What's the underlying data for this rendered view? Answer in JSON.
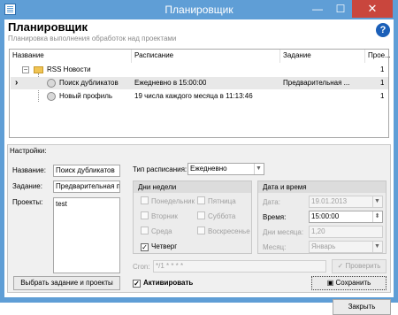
{
  "window": {
    "title": "Планировщик",
    "min_glyph": "—",
    "max_glyph": "☐",
    "close_glyph": "✕"
  },
  "header": {
    "title": "Планировщик",
    "subtitle": "Планировка выполнения обработок над проектами",
    "help_glyph": "?"
  },
  "tree": {
    "columns": [
      "Название",
      "Расписание",
      "Задание",
      "Прое..."
    ],
    "expander_glyph": "−",
    "current_row_glyph": "›",
    "rows": [
      {
        "name": "RSS Новости",
        "schedule": "",
        "task": "",
        "projects": "1",
        "type": "folder"
      },
      {
        "name": "Поиск дубликатов",
        "schedule": "Ежедневно в 15:00:00",
        "task": "Предварительная ...",
        "projects": "1",
        "type": "task",
        "selected": true
      },
      {
        "name": "Новый профиль",
        "schedule": "19 числа каждого месяца в 11:13:46",
        "task": "",
        "projects": "1",
        "type": "task"
      }
    ]
  },
  "settings": {
    "title": "Настройки:",
    "name_label": "Название:",
    "name_value": "Поиск дубликатов",
    "task_label": "Задание:",
    "task_value": "Предварительная пс",
    "projects_label": "Проекты:",
    "projects_value": "test",
    "select_button": "Выбрать задание и проекты",
    "schedule_type_label": "Тип расписания:",
    "schedule_type_value": "Ежедневно",
    "weekdays_title": "Дни недели",
    "weekdays": [
      {
        "label": "Понедельник",
        "checked": false
      },
      {
        "label": "Пятница",
        "checked": false
      },
      {
        "label": "Вторник",
        "checked": false
      },
      {
        "label": "Суббота",
        "checked": false
      },
      {
        "label": "Среда",
        "checked": false
      },
      {
        "label": "Воскресенье",
        "checked": false
      },
      {
        "label": "Четверг",
        "checked": true
      }
    ],
    "datetime_title": "Дата и время",
    "date_label": "Дата:",
    "date_value": "19.01.2013",
    "time_label": "Время:",
    "time_value": "15:00:00",
    "monthdays_label": "Дни месяца:",
    "monthdays_value": "1,20",
    "month_label": "Месяц:",
    "month_value": "Январь",
    "cron_label": "Cron:",
    "cron_value": "*/1 * * * *",
    "check_button": "✓ Проверить",
    "activate_label": "Активировать",
    "activate_checked": true,
    "save_button": "Сохранить"
  },
  "footer": {
    "close_button": "Закрыть"
  }
}
